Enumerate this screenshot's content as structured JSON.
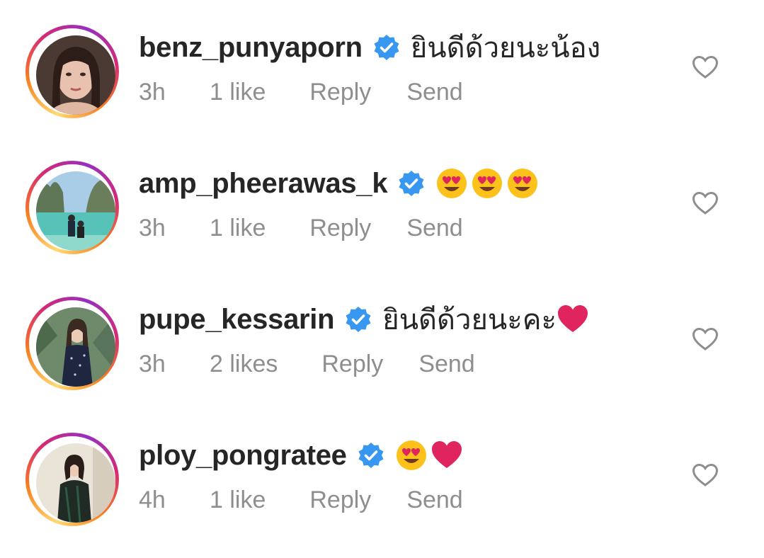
{
  "comments": [
    {
      "username": "benz_punyaporn",
      "verified": true,
      "text": "ยินดีด้วยนะน้อง",
      "emojis": [],
      "time": "3h",
      "likes": "1 like",
      "reply": "Reply",
      "send": "Send"
    },
    {
      "username": "amp_pheerawas_k",
      "verified": true,
      "text": "",
      "emojis": [
        "heart-eyes",
        "heart-eyes",
        "heart-eyes"
      ],
      "time": "3h",
      "likes": "1 like",
      "reply": "Reply",
      "send": "Send"
    },
    {
      "username": "pupe_kessarin",
      "verified": true,
      "text": "ยินดีด้วยนะคะ",
      "emojis": [
        "red-heart"
      ],
      "time": "3h",
      "likes": "2 likes",
      "reply": "Reply",
      "send": "Send"
    },
    {
      "username": "ploy_pongratee",
      "verified": true,
      "text": "",
      "emojis": [
        "heart-eyes",
        "red-heart"
      ],
      "time": "4h",
      "likes": "1 like",
      "reply": "Reply",
      "send": "Send"
    }
  ],
  "colors": {
    "verified_blue": "#3897f0",
    "meta_gray": "#8e8e8e",
    "text": "#262626",
    "heart_red": "#e0245e"
  }
}
